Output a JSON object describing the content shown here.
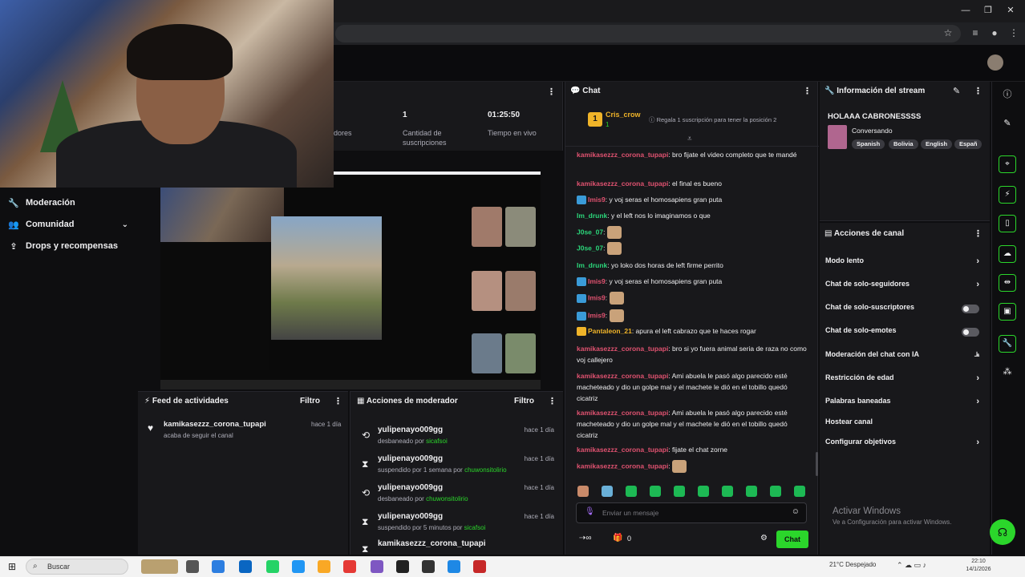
{
  "nav": {
    "moderation": "Moderación",
    "community": "Comunidad",
    "drops": "Drops y recompensas"
  },
  "stats": {
    "followers_label": "dores",
    "subs_value": "1",
    "subs_label": "Cantidad de suscripciones",
    "live_value": "01:25:50",
    "live_label": "Tiempo en vivo"
  },
  "feed": {
    "title": "Feed de actividades",
    "filter": "Filtro",
    "item_user": "kamikasezzz_corona_tupapi",
    "item_action": "acaba de seguir el canal",
    "item_time": "hace 1 día"
  },
  "mod": {
    "title": "Acciones de moderador",
    "filter": "Filtro",
    "rows": [
      {
        "user": "yulipenayo009gg",
        "action": "desbaneado por ",
        "by": "sicafsoi",
        "time": "hace 1 día"
      },
      {
        "user": "yulipenayo009gg",
        "action": "suspendido por 1 semana por ",
        "by": "chuwonsitolirio",
        "time": "hace 1 día"
      },
      {
        "user": "yulipenayo009gg",
        "action": "desbaneado por ",
        "by": "chuwonsitolirio",
        "time": "hace 1 día"
      },
      {
        "user": "yulipenayo009gg",
        "action": "suspendido por 5 minutos por ",
        "by": "sicafsoi",
        "time": "hace 1 día"
      },
      {
        "user": "kamikasezzz_corona_tupapi",
        "action": "",
        "by": "",
        "time": ""
      }
    ]
  },
  "chat": {
    "title": "Chat",
    "pinned_user": "Cris_crow",
    "pinned_count": "1",
    "pinned_hint": "Regala 1 suscripción para tener la posición 2",
    "lines": [
      {
        "user": "kamikasezzz_corona_tupapi",
        "msg": ": bro fijate el video completo que te mandé"
      },
      {
        "user": "kamikasezzz_corona_tupapi",
        "msg": ": el final es bueno"
      },
      {
        "user": "Imis9",
        "msg": ": y voj seras el homosapiens gran puta"
      },
      {
        "user": "Im_drunk",
        "msg": ": y el left nos lo imaginamos o que"
      },
      {
        "user": "J0se_07",
        "msg": ":"
      },
      {
        "user": "J0se_07",
        "msg": ":"
      },
      {
        "user": "Im_drunk",
        "msg": ": yo loko dos horas de left firme perrito"
      },
      {
        "user": "Imis9",
        "msg": ": y voj seras el homosapiens gran puta"
      },
      {
        "user": "Imis9",
        "msg": ":"
      },
      {
        "user": "Imis9",
        "msg": ":"
      },
      {
        "user": "Pantaleon_21",
        "msg": ": apura el left cabrazo que te haces rogar"
      },
      {
        "user": "kamikasezzz_corona_tupapi",
        "msg": ": bro si yo fuera animal seria de raza no como voj callejero"
      },
      {
        "user": "kamikasezzz_corona_tupapi",
        "msg": ": Ami abuela le pasó algo parecido esté macheteado y dio un golpe mal y el machete le dió en el tobillo quedó cicatriz"
      },
      {
        "user": "kamikasezzz_corona_tupapi",
        "msg": ": Ami abuela le pasó algo parecido esté macheteado y dio un golpe mal y el machete le dió en el tobillo quedó cicatriz"
      },
      {
        "user": "kamikasezzz_corona_tupapi",
        "msg": ": fijate el chat zorne"
      },
      {
        "user": "kamikasezzz_corona_tupapi",
        "msg": ":"
      }
    ],
    "input_placeholder": "Enviar un mensaje",
    "points": "0",
    "send": "Chat"
  },
  "stream_info": {
    "title": "Información del stream",
    "stream_title": "HOLAAA CABRONESSSS",
    "category": "Conversando",
    "tags": [
      "Spanish",
      "Bolivia",
      "English",
      "Españ"
    ]
  },
  "channel_actions": {
    "title": "Acciones de canal",
    "rows": [
      {
        "label": "Modo lento",
        "kind": "chevron"
      },
      {
        "label": "Chat de solo-seguidores",
        "kind": "chevron"
      },
      {
        "label": "Chat de solo-suscriptores",
        "kind": "toggle"
      },
      {
        "label": "Chat de solo-emotes",
        "kind": "toggle"
      },
      {
        "label": "Moderación del chat con IA",
        "kind": "chart"
      },
      {
        "label": "Restricción de edad",
        "kind": "chevron"
      },
      {
        "label": "Palabras baneadas",
        "kind": "chevron"
      },
      {
        "label": "Hostear canal",
        "kind": "none"
      },
      {
        "label": "Configurar objetivos",
        "kind": "chevron"
      }
    ]
  },
  "watermark": {
    "line1": "Activar Windows",
    "line2": "Ve a Configuración para activar Windows."
  },
  "taskbar": {
    "search": "Buscar",
    "weather": "21°C  Despejado",
    "time": "22:10",
    "date": "14/1/2026"
  },
  "colors": {
    "accent": "#2bd62b",
    "username_red": "#e05270",
    "username_green": "#2bd67a",
    "panel_bg": "#18181b"
  }
}
